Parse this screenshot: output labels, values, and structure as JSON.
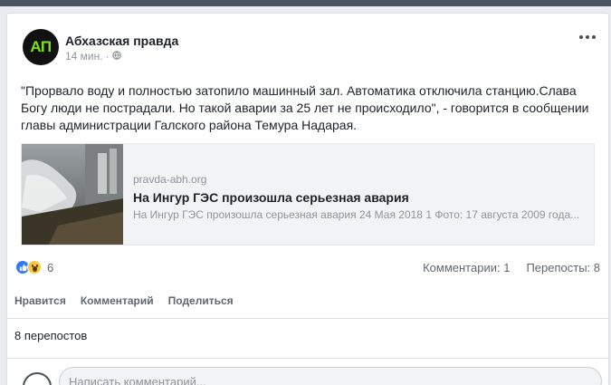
{
  "post": {
    "page_name": "Абхазская правда",
    "avatar_text": "АП",
    "time": "14 мин.",
    "separator": "·",
    "privacy_icon": "globe-icon",
    "text": "\"Прорвало воду и полностью затопило машинный зал. Автоматика отключила станцию.Слава Богу люди не пострадали. Но такой аварии за 25 лет не происходило\", - говорится в сообщении главы администрации Галского района Темура Надарая."
  },
  "link": {
    "domain": "pravda-abh.org",
    "title": "На Ингур ГЭС произошла серьезная авария",
    "description": "На Ингур ГЭС произошла серьезная авария 24 Мая 2018 1 Фото: 17 августа 2009 года..."
  },
  "stats": {
    "reaction_count": "6",
    "comments": "Комментарии: 1",
    "shares": "Перепосты: 8"
  },
  "actions": {
    "like": "Нравится",
    "comment": "Комментарий",
    "share": "Поделиться"
  },
  "shares_summary": "8 перепостов",
  "comment_box": {
    "placeholder": "Написать комментарий..."
  },
  "colors": {
    "avatar_bg": "#111111",
    "avatar_text": "#7ee21a",
    "like_blue": "#2f7bf5",
    "wow_yellow": "#f7c83e"
  }
}
